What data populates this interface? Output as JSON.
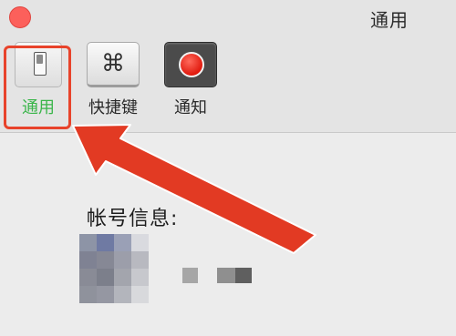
{
  "window": {
    "title": "通用"
  },
  "toolbar": {
    "items": [
      {
        "label": "通用",
        "icon": "switch-icon",
        "selected": true
      },
      {
        "label": "快捷键",
        "icon": "command-key-icon",
        "glyph": "⌘"
      },
      {
        "label": "通知",
        "icon": "record-icon"
      }
    ]
  },
  "account": {
    "title": "帐号信息:"
  },
  "colors": {
    "selected_label": "#3ab54a",
    "annotation_red": "#e8432b",
    "close_button": "#fc605b"
  }
}
